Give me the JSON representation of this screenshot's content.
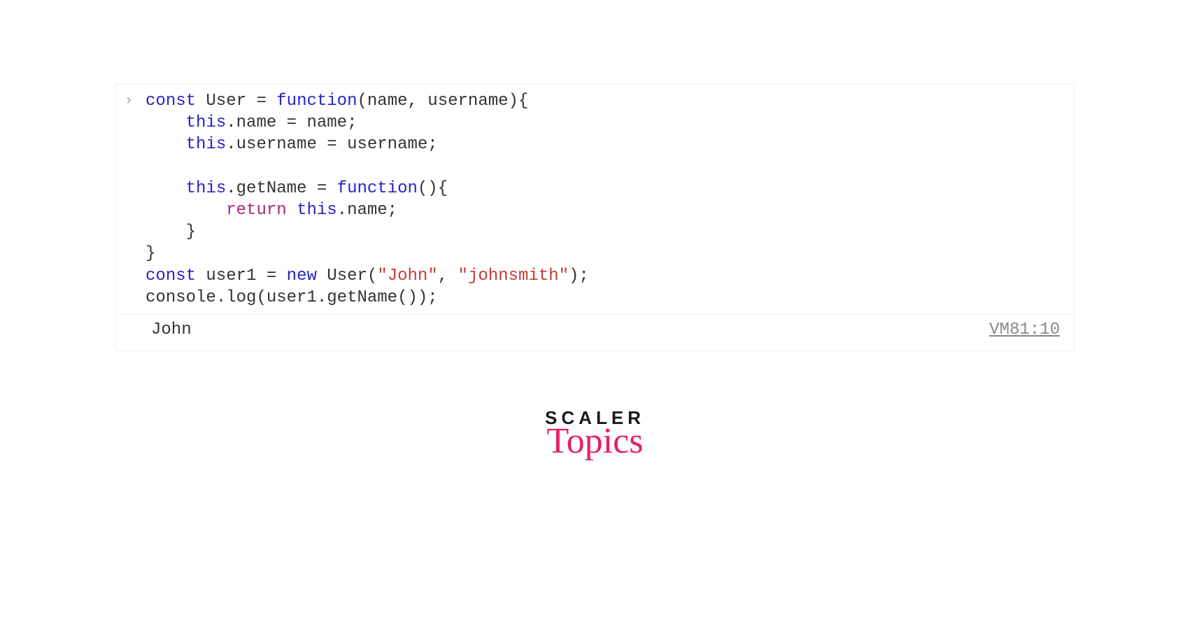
{
  "code": {
    "line1_const": "const",
    "line1_User": " User ",
    "line1_eq": "= ",
    "line1_function": "function",
    "line1_params": "(name, username){",
    "line2_this": "this",
    "line2_rest": ".name = name;",
    "line3_this": "this",
    "line3_rest": ".username = username;",
    "line5_this": "this",
    "line5_mid": ".getName = ",
    "line5_function": "function",
    "line5_paren": "(){",
    "line6_return": "return",
    "line6_sp": " ",
    "line6_this": "this",
    "line6_rest": ".name;",
    "line7_brace": "    }",
    "line8_brace": "}",
    "line9_const": "const",
    "line9_user1": " user1 ",
    "line9_eq": "= ",
    "line9_new": "new",
    "line9_User": " User(",
    "line9_str1": "\"John\"",
    "line9_comma": ", ",
    "line9_str2": "\"johnsmith\"",
    "line9_end": ");",
    "line10": "console.log(user1.getName());"
  },
  "output": {
    "text": "John",
    "source": "VM81:10"
  },
  "logo": {
    "scaler": "SCALER",
    "topics": "Topics"
  }
}
